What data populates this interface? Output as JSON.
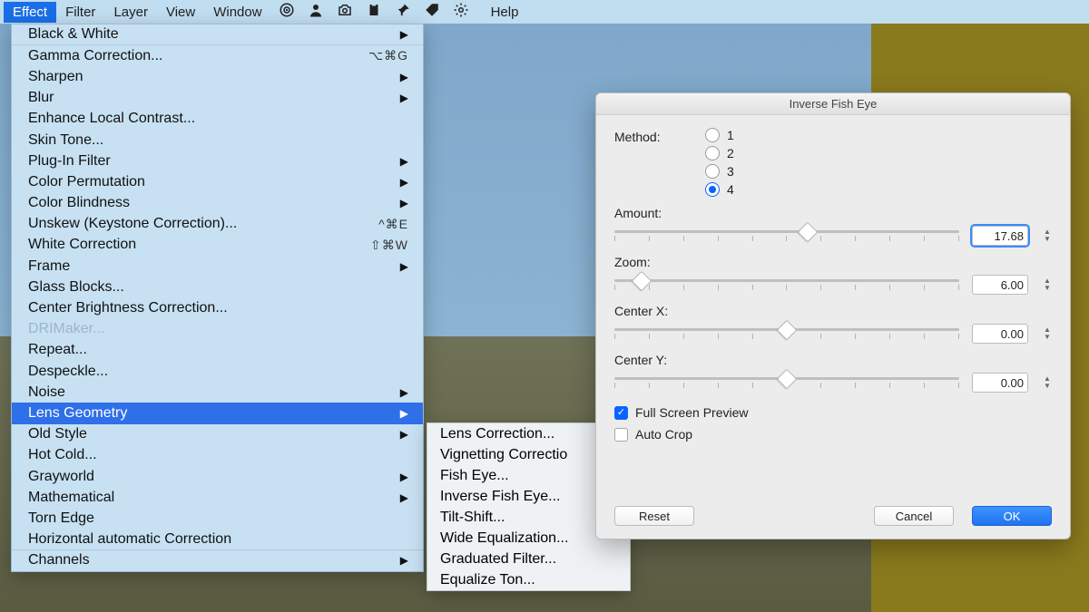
{
  "menubar": {
    "items": [
      "Effect",
      "Filter",
      "Layer",
      "View",
      "Window"
    ],
    "help": "Help",
    "selected": 0
  },
  "effect_menu": {
    "rows": [
      {
        "label": "Black & White",
        "arrow": true,
        "sep": true
      },
      {
        "label": "Gamma Correction...",
        "shortcut": "⌥⌘G"
      },
      {
        "label": "Sharpen",
        "arrow": true
      },
      {
        "label": "Blur",
        "arrow": true
      },
      {
        "label": "Enhance Local Contrast..."
      },
      {
        "label": "Skin Tone..."
      },
      {
        "label": "Plug-In Filter",
        "arrow": true
      },
      {
        "label": "Color Permutation",
        "arrow": true
      },
      {
        "label": "Color Blindness",
        "arrow": true
      },
      {
        "label": "Unskew (Keystone Correction)...",
        "shortcut": "^⌘E"
      },
      {
        "label": "White Correction",
        "shortcut": "⇧⌘W"
      },
      {
        "label": "Frame",
        "arrow": true
      },
      {
        "label": "Glass Blocks..."
      },
      {
        "label": "Center Brightness Correction..."
      },
      {
        "label": "DRIMaker...",
        "dim": true
      },
      {
        "label": "Repeat..."
      },
      {
        "label": "Despeckle..."
      },
      {
        "label": "Noise",
        "arrow": true
      },
      {
        "label": "Lens Geometry",
        "arrow": true,
        "selected": true
      },
      {
        "label": "Old Style",
        "arrow": true
      },
      {
        "label": "Hot Cold..."
      },
      {
        "label": "Grayworld",
        "arrow": true
      },
      {
        "label": "Mathematical",
        "arrow": true
      },
      {
        "label": "Torn Edge"
      },
      {
        "label": "Horizontal automatic Correction",
        "sep": true
      },
      {
        "label": "Channels",
        "arrow": true
      }
    ]
  },
  "submenu": {
    "rows": [
      "Lens Correction...",
      "Vignetting Correctio",
      "Fish Eye...",
      "Inverse Fish Eye...",
      "Tilt-Shift...",
      "Wide Equalization...",
      "Graduated Filter...",
      "Equalize Ton..."
    ]
  },
  "dialog": {
    "title": "Inverse Fish Eye",
    "method_label": "Method:",
    "methods": [
      "1",
      "2",
      "3",
      "4"
    ],
    "method_selected": 3,
    "sliders": [
      {
        "label": "Amount:",
        "value": "17.68",
        "pos": 56,
        "focus": true
      },
      {
        "label": "Zoom:",
        "value": "6.00",
        "pos": 8
      },
      {
        "label": "Center X:",
        "value": "0.00",
        "pos": 50
      },
      {
        "label": "Center Y:",
        "value": "0.00",
        "pos": 50
      }
    ],
    "checks": [
      {
        "label": "Full Screen Preview",
        "on": true
      },
      {
        "label": "Auto Crop",
        "on": false
      }
    ],
    "buttons": {
      "reset": "Reset",
      "cancel": "Cancel",
      "ok": "OK"
    }
  }
}
